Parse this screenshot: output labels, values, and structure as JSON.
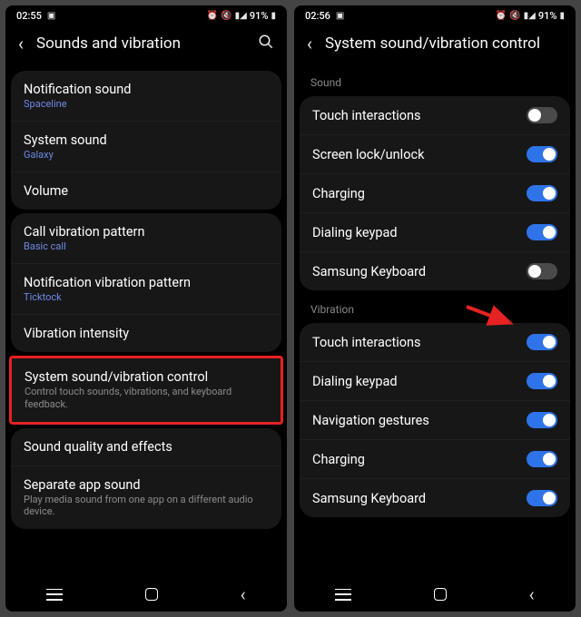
{
  "left": {
    "statusbar": {
      "time": "02:55",
      "battery": "91%"
    },
    "title": "Sounds and vibration",
    "groups": [
      {
        "rows": [
          {
            "title": "Notification sound",
            "sub": "Spaceline",
            "subColor": "blue"
          },
          {
            "title": "System sound",
            "sub": "Galaxy",
            "subColor": "blue"
          },
          {
            "title": "Volume"
          }
        ]
      },
      {
        "rows": [
          {
            "title": "Call vibration pattern",
            "sub": "Basic call",
            "subColor": "blue"
          },
          {
            "title": "Notification vibration pattern",
            "sub": "Ticktock",
            "subColor": "blue"
          },
          {
            "title": "Vibration intensity"
          }
        ]
      },
      {
        "highlight": true,
        "rows": [
          {
            "title": "System sound/vibration control",
            "sub": "Control touch sounds, vibrations, and keyboard feedback.",
            "subColor": "grey"
          }
        ]
      },
      {
        "rows": [
          {
            "title": "Sound quality and effects"
          },
          {
            "title": "Separate app sound",
            "sub": "Play media sound from one app on a different audio device.",
            "subColor": "grey"
          }
        ]
      }
    ]
  },
  "right": {
    "statusbar": {
      "time": "02:56",
      "battery": "91%"
    },
    "title": "System sound/vibration control",
    "sections": [
      {
        "head": "Sound",
        "rows": [
          {
            "title": "Touch interactions",
            "on": false
          },
          {
            "title": "Screen lock/unlock",
            "on": true
          },
          {
            "title": "Charging",
            "on": true
          },
          {
            "title": "Dialing keypad",
            "on": true
          },
          {
            "title": "Samsung Keyboard",
            "on": false,
            "arrow": true
          }
        ]
      },
      {
        "head": "Vibration",
        "rows": [
          {
            "title": "Touch interactions",
            "on": true
          },
          {
            "title": "Dialing keypad",
            "on": true
          },
          {
            "title": "Navigation gestures",
            "on": true
          },
          {
            "title": "Charging",
            "on": true
          },
          {
            "title": "Samsung Keyboard",
            "on": true
          }
        ]
      }
    ]
  }
}
